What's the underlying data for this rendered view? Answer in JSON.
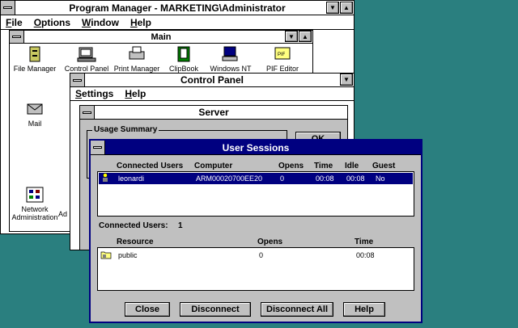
{
  "program_manager": {
    "title": "Program Manager - MARKETING\\Administrator",
    "menu": [
      "File",
      "Options",
      "Window",
      "Help"
    ]
  },
  "main_group": {
    "title": "Main",
    "icons": [
      "File Manager",
      "Control Panel",
      "Print Manager",
      "ClipBook",
      "Windows NT",
      "PIF Editor",
      "Mail",
      "Network Administration",
      "Ad"
    ]
  },
  "control_panel": {
    "title": "Control Panel",
    "menu": [
      "Settings",
      "Help"
    ]
  },
  "server": {
    "title": "Server",
    "usage_summary": "Usage Summary",
    "ok": "OK"
  },
  "user_sessions": {
    "title": "User Sessions",
    "columns": [
      "Connected Users",
      "Computer",
      "Opens",
      "Time",
      "Idle",
      "Guest"
    ],
    "rows": [
      {
        "user": "leonardi",
        "computer": "ARM00020700EE20",
        "opens": "0",
        "time": "00:08",
        "idle": "00:08",
        "guest": "No"
      }
    ],
    "connected_label": "Connected Users:",
    "connected_count": "1",
    "resource_columns": [
      "Resource",
      "Opens",
      "Time"
    ],
    "resources": [
      {
        "resource": "public",
        "opens": "0",
        "time": "00:08"
      }
    ],
    "buttons": {
      "close": "Close",
      "disconnect": "Disconnect",
      "disconnect_all": "Disconnect All",
      "help": "Help"
    }
  }
}
